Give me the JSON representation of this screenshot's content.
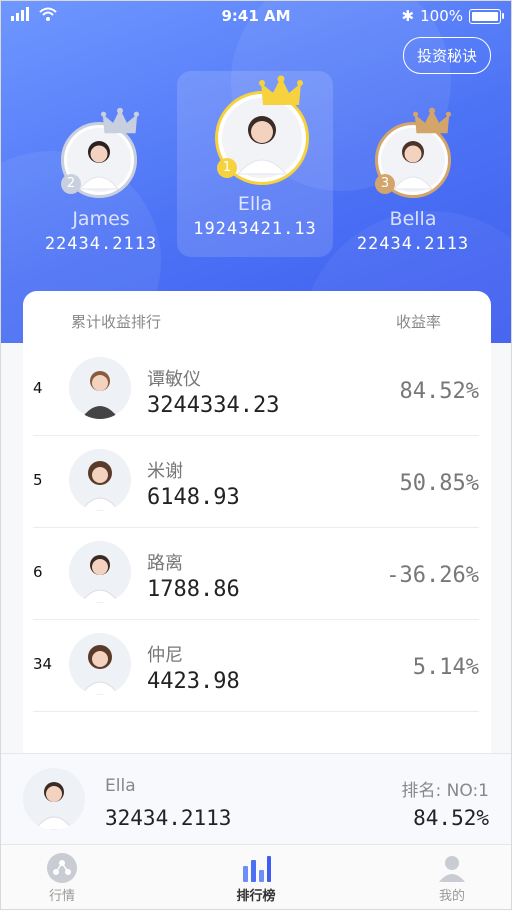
{
  "status_bar": {
    "time": "9:41 AM",
    "battery": "100%"
  },
  "header": {
    "tips_button": "投资秘诀"
  },
  "podium": {
    "first": {
      "name": "Ella",
      "value": "19243421.13",
      "rank": "1"
    },
    "second": {
      "name": "James",
      "value": "22434.2113",
      "rank": "2"
    },
    "third": {
      "name": "Bella",
      "value": "22434.2113",
      "rank": "3"
    }
  },
  "list": {
    "header_left": "累计收益排行",
    "header_right": "收益率",
    "rows": [
      {
        "rank": "4",
        "name": "谭敏仪",
        "amount": "3244334.23",
        "rate": "84.52%"
      },
      {
        "rank": "5",
        "name": "米谢",
        "amount": "6148.93",
        "rate": "50.85%"
      },
      {
        "rank": "6",
        "name": "路离",
        "amount": "1788.86",
        "rate": "-36.26%"
      },
      {
        "rank": "34",
        "name": "仲尼",
        "amount": "4423.98",
        "rate": "5.14%"
      }
    ]
  },
  "me": {
    "name": "Ella",
    "amount": "32434.2113",
    "rank_label": "排名: NO:1",
    "rate": "84.52%"
  },
  "tabs": [
    {
      "label": "行情",
      "icon": "market-icon"
    },
    {
      "label": "排行榜",
      "icon": "ranking-icon"
    },
    {
      "label": "我的",
      "icon": "profile-icon"
    }
  ],
  "colors": {
    "hero_top": "#6f97ff",
    "hero_bottom": "#3f5df0",
    "gold": "#f6d23f",
    "silver": "#c8d0df",
    "bronze": "#d4a56b",
    "active_tab": "#3f5df0"
  }
}
